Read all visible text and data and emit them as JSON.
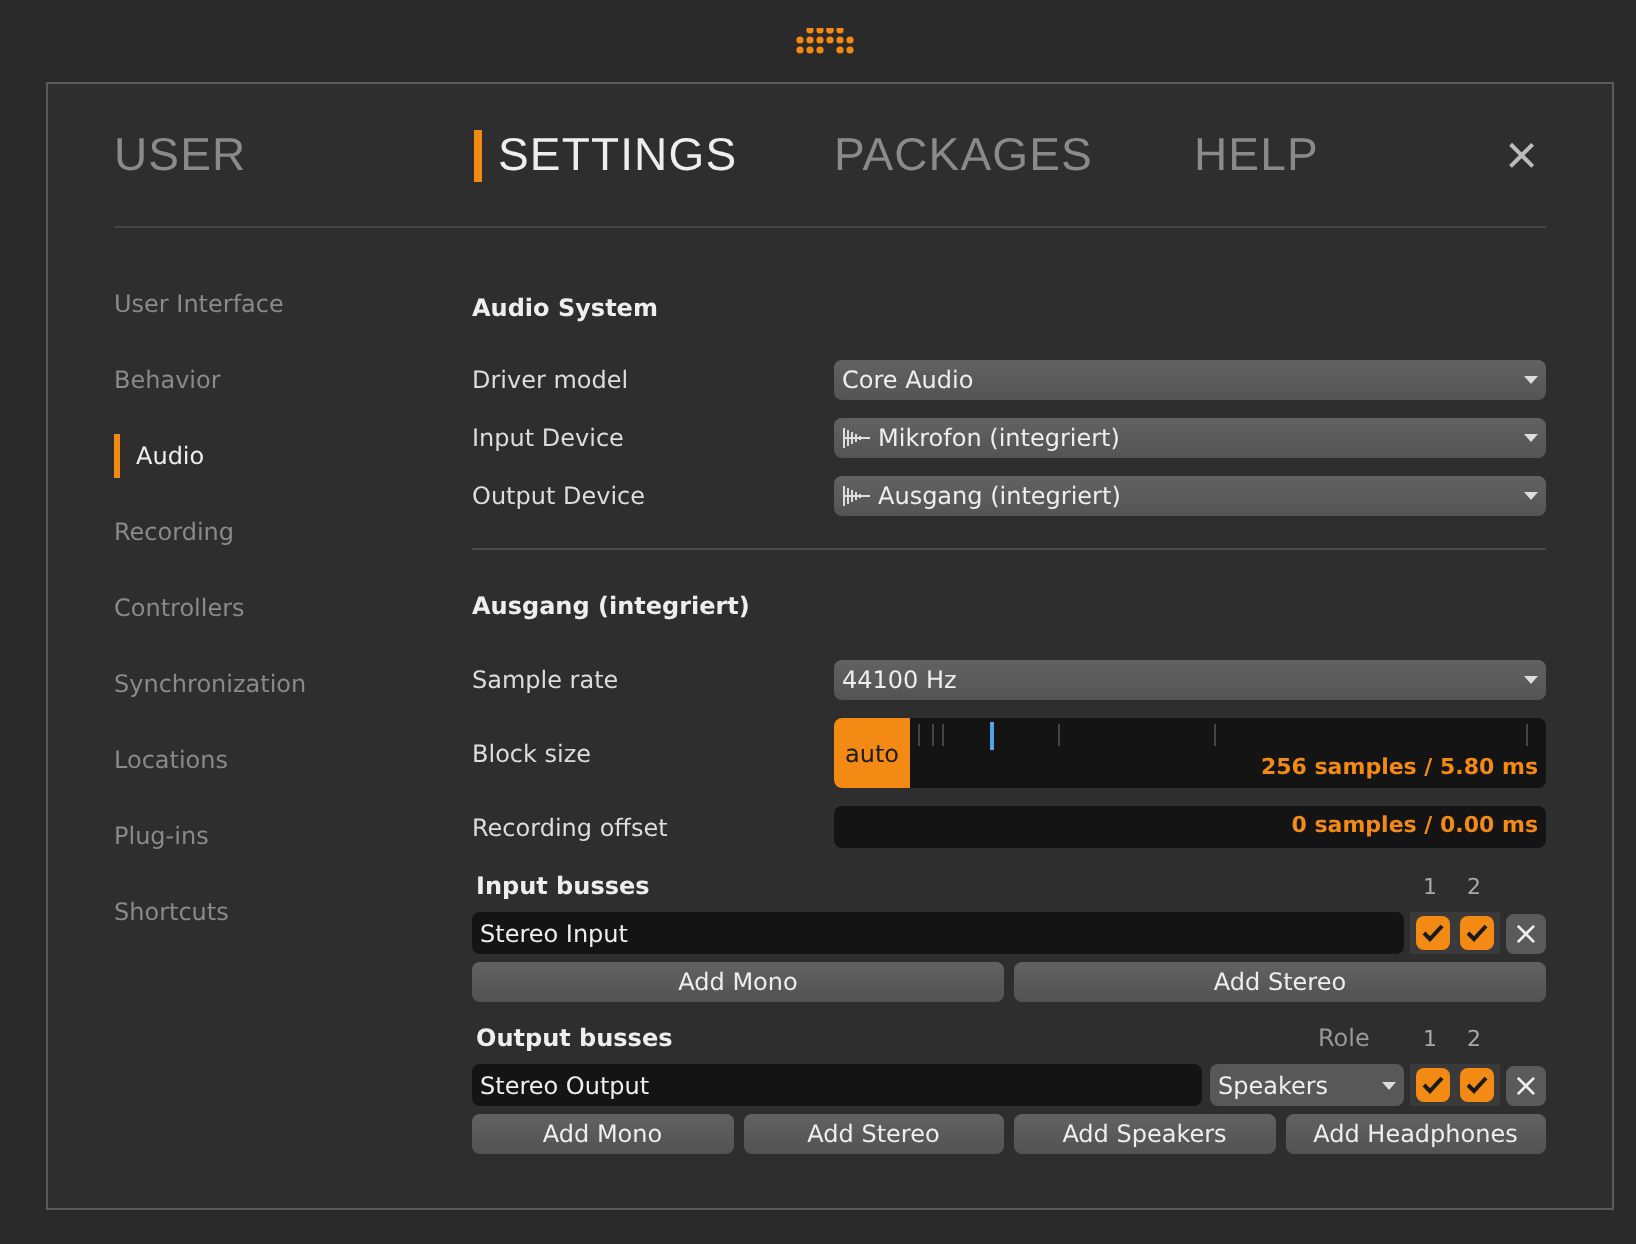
{
  "tabs": [
    {
      "label": "USER",
      "selected": false
    },
    {
      "label": "SETTINGS",
      "selected": true
    },
    {
      "label": "PACKAGES",
      "selected": false
    },
    {
      "label": "HELP",
      "selected": false
    }
  ],
  "close_button": {
    "label": "×"
  },
  "sidebar": {
    "items": [
      {
        "label": "User Interface",
        "selected": false
      },
      {
        "label": "Behavior",
        "selected": false
      },
      {
        "label": "Audio",
        "selected": true
      },
      {
        "label": "Recording",
        "selected": false
      },
      {
        "label": "Controllers",
        "selected": false
      },
      {
        "label": "Synchronization",
        "selected": false
      },
      {
        "label": "Locations",
        "selected": false
      },
      {
        "label": "Plug-ins",
        "selected": false
      },
      {
        "label": "Shortcuts",
        "selected": false
      }
    ]
  },
  "audio_system": {
    "heading": "Audio System",
    "rows": [
      {
        "label": "Driver model",
        "value": "Core Audio",
        "device_icon": false
      },
      {
        "label": "Input Device",
        "value": "Mikrofon (integriert)",
        "device_icon": true
      },
      {
        "label": "Output Device",
        "value": "Ausgang (integriert)",
        "device_icon": true
      }
    ]
  },
  "device": {
    "heading": "Ausgang (integriert)",
    "sample_rate": {
      "label": "Sample rate",
      "value": "44100 Hz"
    },
    "block_size": {
      "label": "Block size",
      "auto_label": "auto",
      "auto_on": true,
      "level": 0.125,
      "reading": "256 samples / 5.80 ms"
    },
    "recording_offset": {
      "label": "Recording offset",
      "reading": "0 samples / 0.00 ms"
    }
  },
  "input_busses": {
    "heading": "Input busses",
    "channel_headers": [
      "1",
      "2"
    ],
    "busses": [
      {
        "name": "Stereo Input",
        "channels": [
          {
            "checked": true
          },
          {
            "checked": true
          }
        ],
        "remove": "×"
      }
    ],
    "buttons": [
      "Add Mono",
      "Add Stereo"
    ]
  },
  "output_busses": {
    "heading": "Output busses",
    "role_header": "Role",
    "channel_headers": [
      "1",
      "2"
    ],
    "busses": [
      {
        "name": "Stereo Output",
        "role": "Speakers",
        "channels": [
          {
            "checked": true
          },
          {
            "checked": true
          }
        ],
        "remove": "×"
      }
    ],
    "buttons": [
      "Add Mono",
      "Add Stereo",
      "Add Speakers",
      "Add Headphones"
    ]
  }
}
